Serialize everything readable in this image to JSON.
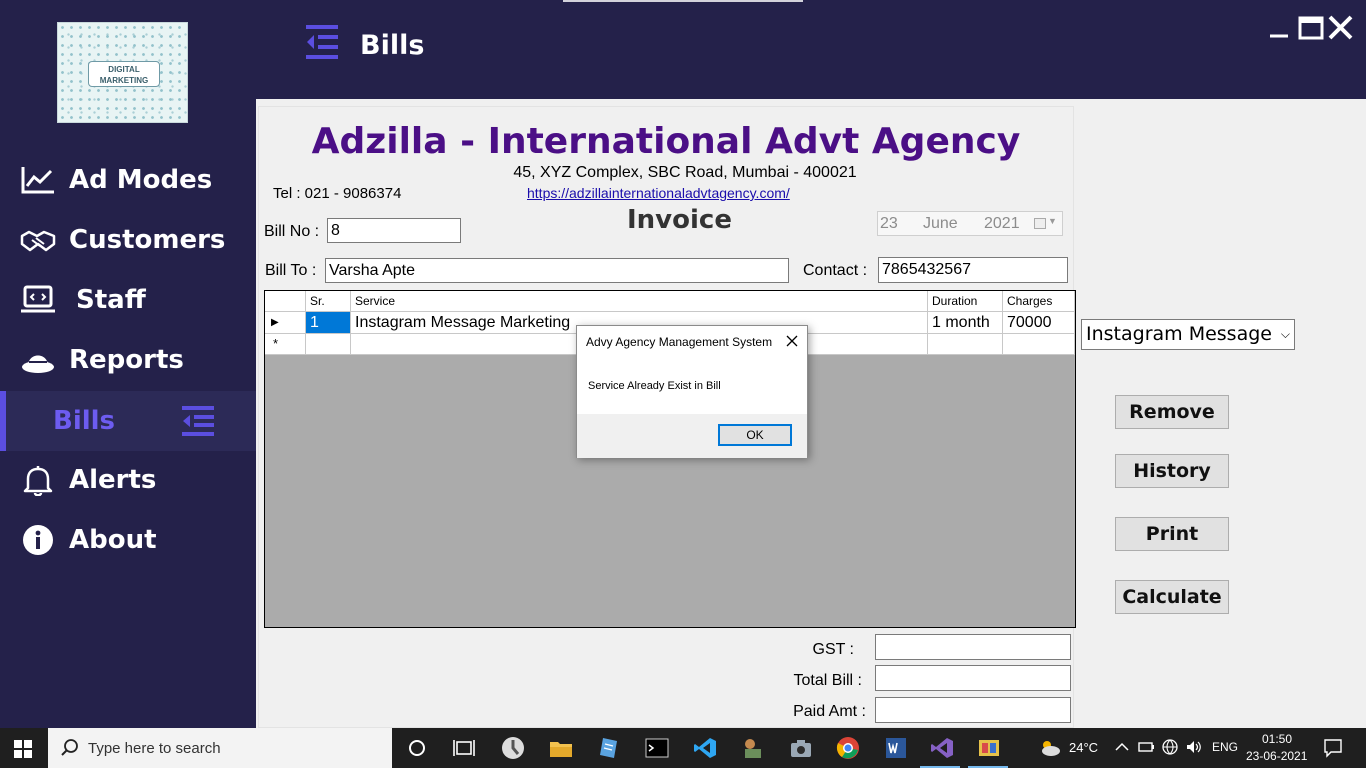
{
  "window": {
    "title": "Bills"
  },
  "sidebar": {
    "logo_text_1": "DIGITAL",
    "logo_text_2": "MARKETING",
    "items": [
      {
        "label": "Ad Modes",
        "icon": "chart-line-icon"
      },
      {
        "label": "Customers",
        "icon": "handshake-icon"
      },
      {
        "label": "Staff",
        "icon": "laptop-icon"
      },
      {
        "label": "Reports",
        "icon": "hat-icon"
      },
      {
        "label": "Bills",
        "icon": "list-icon",
        "active": true
      },
      {
        "label": "Alerts",
        "icon": "bell-icon"
      },
      {
        "label": "About",
        "icon": "info-icon"
      }
    ]
  },
  "invoice": {
    "company": "Adzilla - International Advt Agency",
    "address": "45, XYZ Complex, SBC Road, Mumbai - 400021",
    "tel": "Tel : 021 - 9086374",
    "website": "https://adzillainternationaladvtagency.com/",
    "title": "Invoice",
    "bill_no_label": "Bill No :",
    "bill_no": "8",
    "date": {
      "day": "23",
      "month": "June",
      "year": "2021"
    },
    "bill_to_label": "Bill To :",
    "bill_to": "Varsha Apte",
    "contact_label": "Contact :",
    "contact": "7865432567",
    "grid": {
      "columns": [
        "Sr.",
        "Service",
        "Duration",
        "Charges"
      ],
      "rows": [
        {
          "sr": "1",
          "service": "Instagram Message Marketing",
          "duration": "1 month",
          "charges": "70000"
        }
      ],
      "new_row_marker": "*"
    },
    "gst_label": "GST :",
    "total_label": "Total Bill :",
    "paid_label": "Paid Amt :",
    "gst": "",
    "total": "",
    "paid": ""
  },
  "dialog": {
    "title": "Advy Agency Management System",
    "message": "Service Already Exist in Bill",
    "ok": "OK"
  },
  "actions": {
    "service_selected": "Instagram Message Marketing",
    "remove": "Remove",
    "history": "History",
    "print": "Print",
    "calculate": "Calculate"
  },
  "taskbar": {
    "search_placeholder": "Type here to search",
    "temperature": "24°C",
    "language": "ENG",
    "time": "01:50",
    "date": "23-06-2021"
  },
  "colors": {
    "sidebar_bg": "#24214a",
    "accent": "#5b4ee0",
    "company_title": "#4b0f86"
  }
}
